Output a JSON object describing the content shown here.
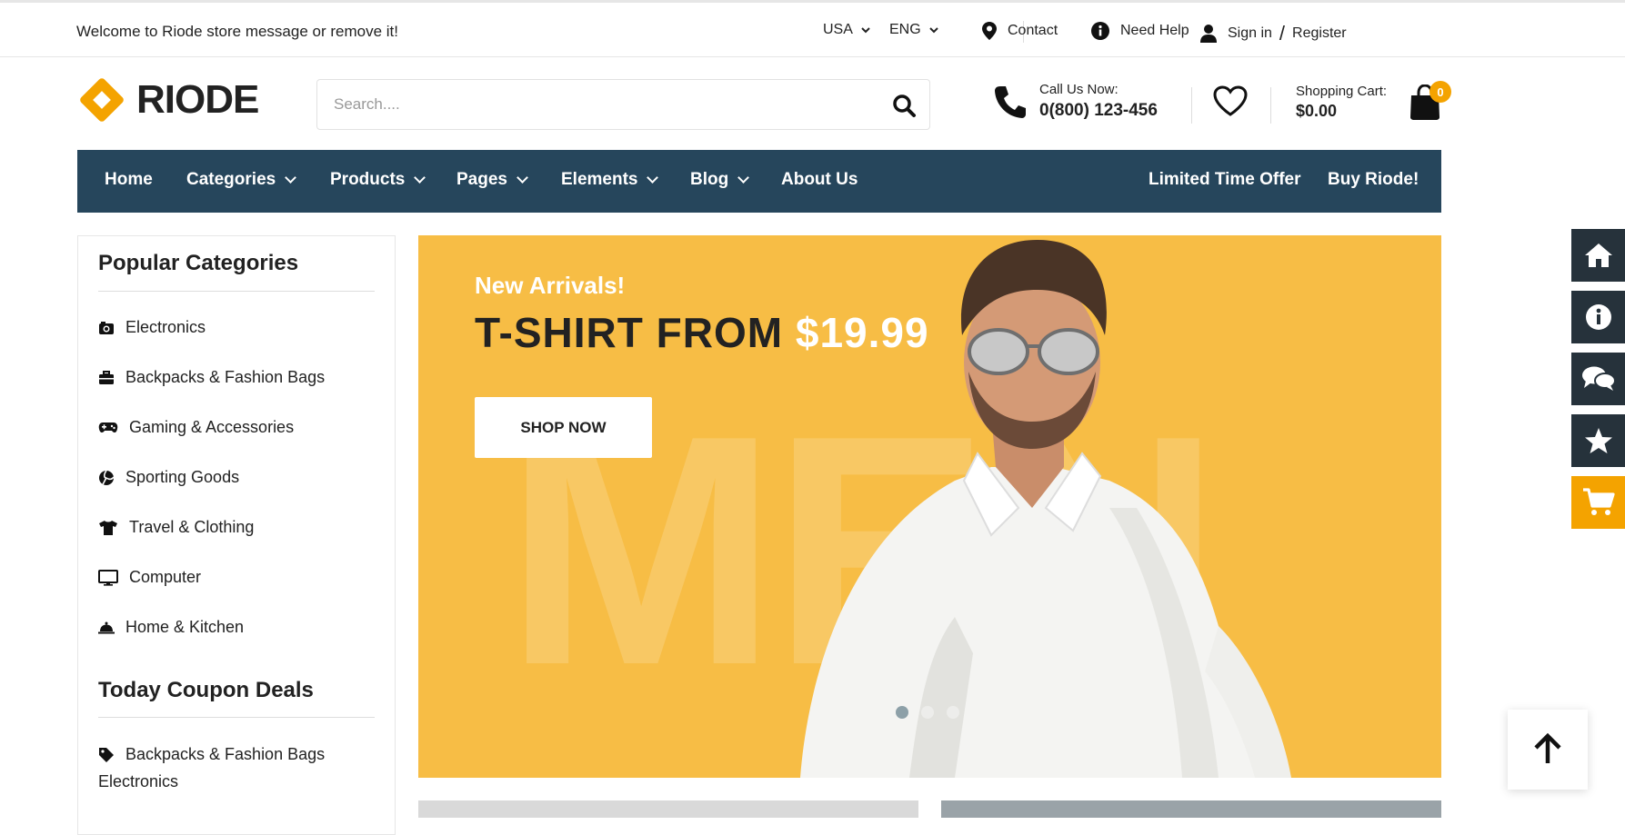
{
  "topbar": {
    "welcome": "Welcome to Riode store message or remove it!",
    "currency": "USA",
    "language": "ENG",
    "contact": "Contact",
    "help": "Need Help",
    "signin": "Sign in",
    "slash": "/",
    "register": "Register"
  },
  "header": {
    "logo": "RIODE",
    "search_placeholder": "Search....",
    "call_label": "Call Us Now:",
    "call_number": "0(800) 123-456",
    "cart_label": "Shopping Cart:",
    "cart_total": "$0.00",
    "cart_count": "0"
  },
  "nav": {
    "items": [
      "Home",
      "Categories",
      "Products",
      "Pages",
      "Elements",
      "Blog",
      "About Us"
    ],
    "right": [
      "Limited Time Offer",
      "Buy Riode!"
    ]
  },
  "sidebar": {
    "popular_title": "Popular Categories",
    "categories": [
      {
        "label": "Electronics",
        "icon": "camera-icon"
      },
      {
        "label": "Backpacks & Fashion Bags",
        "icon": "briefcase-icon"
      },
      {
        "label": "Gaming & Accessories",
        "icon": "gamepad-icon"
      },
      {
        "label": "Sporting Goods",
        "icon": "volleyball-icon"
      },
      {
        "label": "Travel & Clothing",
        "icon": "tshirt-icon"
      },
      {
        "label": "Computer",
        "icon": "monitor-icon"
      },
      {
        "label": "Home & Kitchen",
        "icon": "cloche-icon"
      }
    ],
    "coupon_title": "Today Coupon Deals",
    "coupon_line1": "Backpacks & Fashion Bags",
    "coupon_line2": "Electronics"
  },
  "banner": {
    "subtitle": "New Arrivals!",
    "title": "T-SHIRT FROM",
    "price": "$19.99",
    "button": "SHOP NOW",
    "bg_word": "MEN",
    "active_slide": 1,
    "slide_count": 3
  },
  "colors": {
    "accent": "#f4a300",
    "nav_bg": "#26465c",
    "banner_bg": "#f7bd45",
    "tool_bg": "#26323b"
  }
}
